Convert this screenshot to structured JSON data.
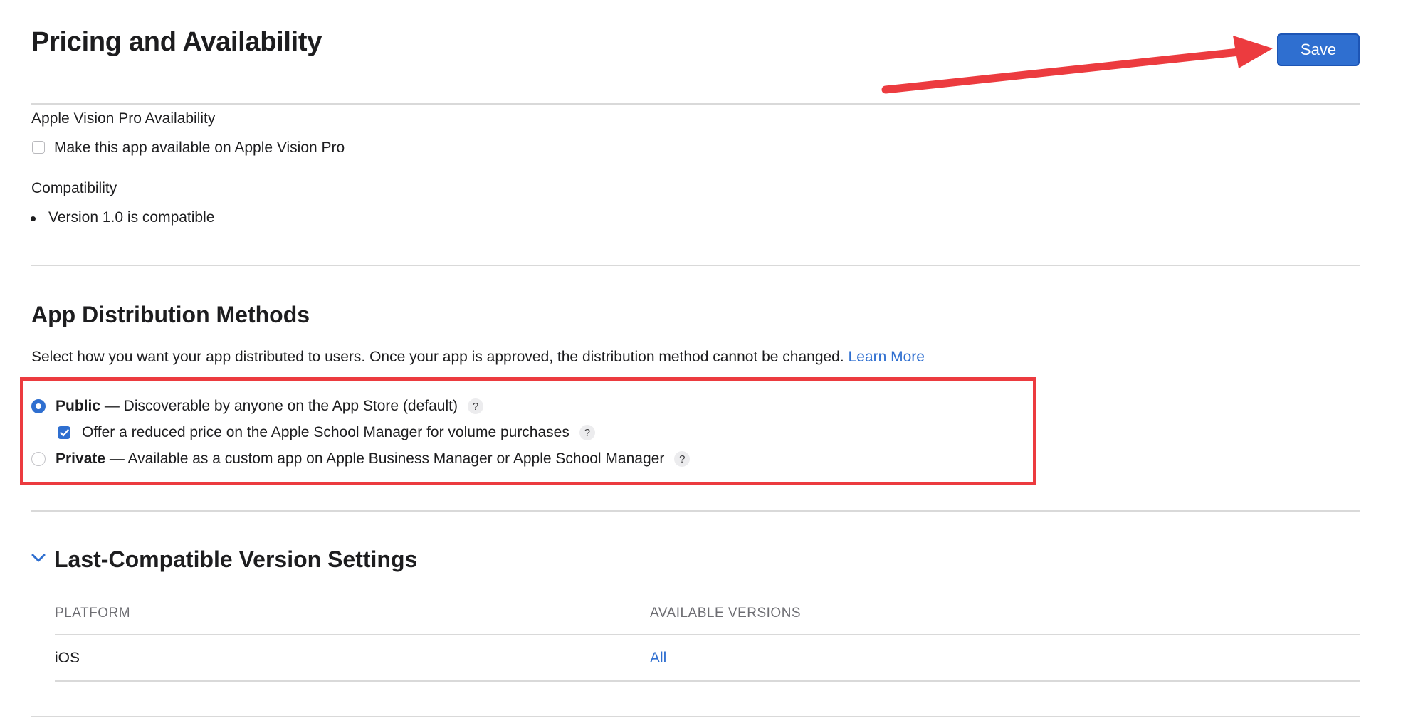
{
  "header": {
    "title": "Pricing and Availability",
    "save_label": "Save"
  },
  "vision_pro": {
    "heading": "Apple Vision Pro Availability",
    "checkbox_label": "Make this app available on Apple Vision Pro",
    "checked": false
  },
  "compatibility": {
    "heading": "Compatibility",
    "items": [
      "Version 1.0 is compatible"
    ]
  },
  "distribution": {
    "title": "App Distribution Methods",
    "description": "Select how you want your app distributed to users. Once your app is approved, the distribution method cannot be changed.",
    "learn_more": "Learn More",
    "public": {
      "label": "Public",
      "description": " — Discoverable by anyone on the App Store (default)",
      "selected": true,
      "help": "?"
    },
    "reduced_price": {
      "label": "Offer a reduced price on the Apple School Manager for volume purchases",
      "checked": true,
      "help": "?"
    },
    "private": {
      "label": "Private",
      "description": " — Available as a custom app on Apple Business Manager or Apple School Manager",
      "selected": false,
      "help": "?"
    }
  },
  "last_compatible": {
    "title": "Last-Compatible Version Settings",
    "columns": [
      "PLATFORM",
      "AVAILABLE VERSIONS"
    ],
    "rows": [
      {
        "platform": "iOS",
        "versions": "All"
      }
    ]
  },
  "colors": {
    "accent": "#2f6fd0",
    "annotation_red": "#ec3b3f"
  }
}
